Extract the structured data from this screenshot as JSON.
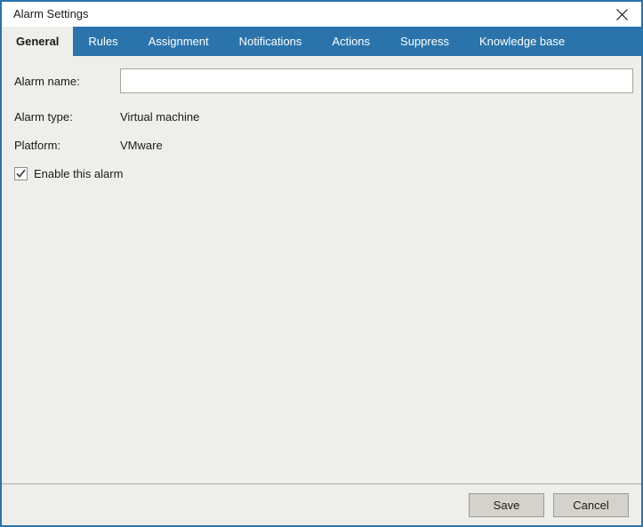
{
  "window": {
    "title": "Alarm Settings",
    "close_icon": "close-icon",
    "accent_color": "#2b74ab",
    "content_background": "#eeeeea"
  },
  "tabs": [
    {
      "label": "General",
      "selected": true
    },
    {
      "label": "Rules",
      "selected": false
    },
    {
      "label": "Assignment",
      "selected": false
    },
    {
      "label": "Notifications",
      "selected": false
    },
    {
      "label": "Actions",
      "selected": false
    },
    {
      "label": "Suppress",
      "selected": false
    },
    {
      "label": "Knowledge base",
      "selected": false
    }
  ],
  "general": {
    "alarm_name_label": "Alarm name:",
    "alarm_name_value": "",
    "alarm_name_placeholder": "",
    "alarm_type_label": "Alarm type:",
    "alarm_type_value": "Virtual machine",
    "platform_label": "Platform:",
    "platform_value": "VMware",
    "enable_label": "Enable this alarm",
    "enable_checked": true,
    "check_icon": "check-icon"
  },
  "footer": {
    "save_label": "Save",
    "cancel_label": "Cancel"
  }
}
